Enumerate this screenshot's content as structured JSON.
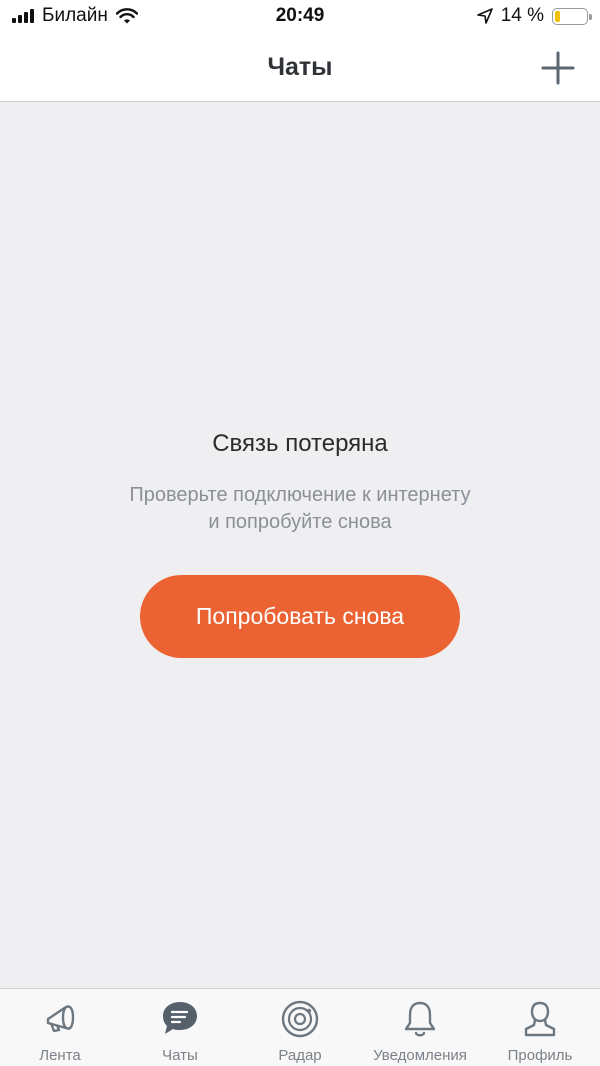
{
  "status_bar": {
    "carrier": "Билайн",
    "time": "20:49",
    "battery": "14 %"
  },
  "header": {
    "title": "Чаты"
  },
  "empty_state": {
    "title": "Связь потеряна",
    "message_line1": "Проверьте подключение к интернету",
    "message_line2": "и попробуйте снова",
    "retry_label": "Попробовать снова"
  },
  "tab_bar": {
    "items": [
      {
        "label": "Лента",
        "icon": "megaphone-icon"
      },
      {
        "label": "Чаты",
        "icon": "chat-bubble-icon"
      },
      {
        "label": "Радар",
        "icon": "radar-icon"
      },
      {
        "label": "Уведомления",
        "icon": "bell-icon"
      },
      {
        "label": "Профиль",
        "icon": "person-icon"
      }
    ]
  },
  "colors": {
    "accent": "#ec6333",
    "background": "#efeff1",
    "icon_gray": "#6d7780"
  }
}
